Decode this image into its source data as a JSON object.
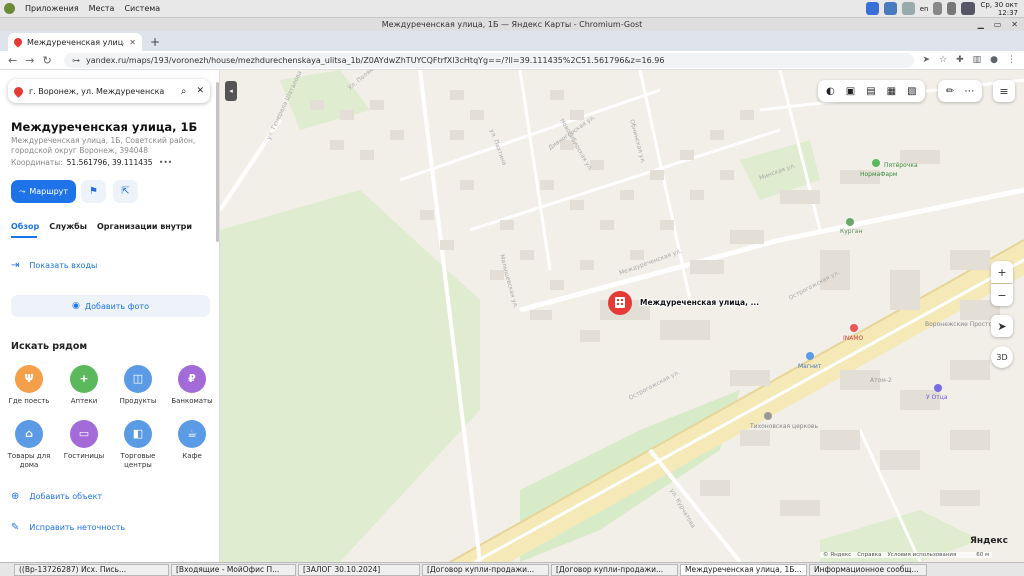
{
  "desktop": {
    "menu": [
      "Приложения",
      "Места",
      "Система"
    ],
    "lang": "en",
    "clock_day": "Ср, 30 окт",
    "clock_time": "12:37"
  },
  "window": {
    "title": "Междуреченская улица, 1Б — Яндекс Карты - Chromium-Gost"
  },
  "browser": {
    "tab_title": "Междуреченская улица, 1Б",
    "url": "yandex.ru/maps/193/voronezh/house/mezhdurechenskaya_ulitsa_1b/Z0AYdwZhTUYCQFtrfXl3cHtqYg==/?ll=39.111435%2C51.561796&z=16.96"
  },
  "panel": {
    "search_value": "г. Воронеж, ул. Междуреченска",
    "title": "Междуреченская улица, 1Б",
    "address": "Междуреченская улица, 1Б, Советский район, городской округ Воронеж, 394048",
    "coords_label": "Координаты:",
    "coords_value": "51.561796, 39.111435",
    "coords_more": "•••",
    "route_label": "Маршрут",
    "tabs": [
      "Обзор",
      "Службы",
      "Организации внутри"
    ],
    "show_entrances": "Показать входы",
    "add_photo": "Добавить фото",
    "nearby_title": "Искать рядом",
    "categories": [
      {
        "label": "Где поесть",
        "color": "#f4a04a",
        "glyph": "Ψ"
      },
      {
        "label": "Аптеки",
        "color": "#5cb85c",
        "glyph": "+"
      },
      {
        "label": "Продукты",
        "color": "#5b9be6",
        "glyph": "◫"
      },
      {
        "label": "Банкоматы",
        "color": "#a36bd8",
        "glyph": "₽"
      },
      {
        "label": "Товары для дома",
        "color": "#5b9be6",
        "glyph": "⌂"
      },
      {
        "label": "Гостиницы",
        "color": "#a36bd8",
        "glyph": "▭"
      },
      {
        "label": "Торговые центры",
        "color": "#5b9be6",
        "glyph": "◧"
      },
      {
        "label": "Кафе",
        "color": "#5b9be6",
        "glyph": "☕"
      }
    ],
    "add_object": "Добавить объект",
    "fix_error": "Исправить неточность"
  },
  "map": {
    "pin_label": "Междуреченская улица, ...",
    "streets": [
      "Острогожская ул.",
      "Острогожская ул.",
      "ул. Генерала Шаталова",
      "Дивногорская ул.",
      "Минская ул.",
      "ул. Пахтина",
      "ул. Курчатова",
      "Междуреченская ул.",
      "Малышевская ул.",
      "Ул. Полякова",
      "Новосибирская ул.",
      "Обнинская ул."
    ],
    "pois": [
      "Пятёрочка",
      "НормаФарм",
      "Курган",
      "INAMO",
      "Магнит",
      "Тихоновская церковь",
      "Воронежские Просторы",
      "У Отца",
      "Атом-2"
    ],
    "logo": "Яндекс",
    "footer": [
      "© Яндекс",
      "Справка",
      "Условия использования"
    ],
    "scale": "60 м",
    "three_d": "3D"
  },
  "taskbar": {
    "items": [
      "((Вр-13726287) Исх. Пись...",
      "[Входящие - МойОфис П...",
      "[ЗАЛОГ 30.10.2024]",
      "[Договор купли-продажи...",
      "[Договор купли-продажи...",
      "Междуреченская улица, 1Б...",
      "Информационное сообщ..."
    ]
  }
}
